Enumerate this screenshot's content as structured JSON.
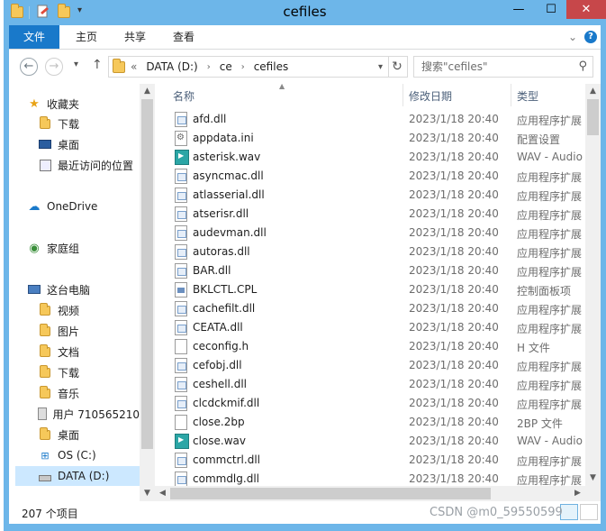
{
  "window": {
    "title": "cefiles",
    "minimize": "—",
    "maximize": "☐",
    "close": "✕"
  },
  "ribbon": {
    "tabs": [
      "文件",
      "主页",
      "共享",
      "查看"
    ],
    "expand_icon": "chevron-down-icon",
    "help": "?"
  },
  "navigation": {
    "back": "←",
    "forward": "→",
    "recent": "▾",
    "up": "↑",
    "path_prefix": "«",
    "breadcrumbs": [
      "DATA (D:)",
      "ce",
      "cefiles"
    ],
    "refresh": "↻",
    "search_placeholder": "搜索\"cefiles\""
  },
  "sidebar": {
    "items": [
      {
        "label": "收藏夹",
        "icon": "star-icon"
      },
      {
        "label": "下载",
        "icon": "download-folder-icon"
      },
      {
        "label": "桌面",
        "icon": "desktop-icon"
      },
      {
        "label": "最近访问的位置",
        "icon": "recent-places-icon"
      },
      {
        "label": "OneDrive",
        "icon": "cloud-icon"
      },
      {
        "label": "家庭组",
        "icon": "homegroup-icon"
      },
      {
        "label": "这台电脑",
        "icon": "computer-icon"
      },
      {
        "label": "视频",
        "icon": "videos-folder-icon"
      },
      {
        "label": "图片",
        "icon": "pictures-folder-icon"
      },
      {
        "label": "文档",
        "icon": "documents-folder-icon"
      },
      {
        "label": "下载",
        "icon": "download-folder-icon"
      },
      {
        "label": "音乐",
        "icon": "music-folder-icon"
      },
      {
        "label": "用户 710565210",
        "icon": "user-folder-icon"
      },
      {
        "label": "桌面",
        "icon": "desktop-folder-icon"
      },
      {
        "label": "OS (C:)",
        "icon": "windows-drive-icon"
      },
      {
        "label": "DATA (D:)",
        "icon": "drive-icon",
        "selected": true
      }
    ]
  },
  "columns": {
    "name": "名称",
    "date": "修改日期",
    "type": "类型"
  },
  "files": [
    {
      "name": "afd.dll",
      "date": "2023/1/18 20:40",
      "type": "应用程序扩展",
      "kind": "dll"
    },
    {
      "name": "appdata.ini",
      "date": "2023/1/18 20:40",
      "type": "配置设置",
      "kind": "ini"
    },
    {
      "name": "asterisk.wav",
      "date": "2023/1/18 20:40",
      "type": "WAV - Audio Fi",
      "kind": "wav"
    },
    {
      "name": "asyncmac.dll",
      "date": "2023/1/18 20:40",
      "type": "应用程序扩展",
      "kind": "dll"
    },
    {
      "name": "atlasserial.dll",
      "date": "2023/1/18 20:40",
      "type": "应用程序扩展",
      "kind": "dll"
    },
    {
      "name": "atserisr.dll",
      "date": "2023/1/18 20:40",
      "type": "应用程序扩展",
      "kind": "dll"
    },
    {
      "name": "audevman.dll",
      "date": "2023/1/18 20:40",
      "type": "应用程序扩展",
      "kind": "dll"
    },
    {
      "name": "autoras.dll",
      "date": "2023/1/18 20:40",
      "type": "应用程序扩展",
      "kind": "dll"
    },
    {
      "name": "BAR.dll",
      "date": "2023/1/18 20:40",
      "type": "应用程序扩展",
      "kind": "dll"
    },
    {
      "name": "BKLCTL.CPL",
      "date": "2023/1/18 20:40",
      "type": "控制面板项",
      "kind": "cpl"
    },
    {
      "name": "cachefilt.dll",
      "date": "2023/1/18 20:40",
      "type": "应用程序扩展",
      "kind": "dll"
    },
    {
      "name": "CEATA.dll",
      "date": "2023/1/18 20:40",
      "type": "应用程序扩展",
      "kind": "dll"
    },
    {
      "name": "ceconfig.h",
      "date": "2023/1/18 20:40",
      "type": "H 文件",
      "kind": "h"
    },
    {
      "name": "cefobj.dll",
      "date": "2023/1/18 20:40",
      "type": "应用程序扩展",
      "kind": "dll"
    },
    {
      "name": "ceshell.dll",
      "date": "2023/1/18 20:40",
      "type": "应用程序扩展",
      "kind": "dll"
    },
    {
      "name": "clcdckmif.dll",
      "date": "2023/1/18 20:40",
      "type": "应用程序扩展",
      "kind": "dll"
    },
    {
      "name": "close.2bp",
      "date": "2023/1/18 20:40",
      "type": "2BP 文件",
      "kind": "2bp"
    },
    {
      "name": "close.wav",
      "date": "2023/1/18 20:40",
      "type": "WAV - Audio Fi",
      "kind": "wav"
    },
    {
      "name": "commctrl.dll",
      "date": "2023/1/18 20:40",
      "type": "应用程序扩展",
      "kind": "dll"
    },
    {
      "name": "commdlg.dll",
      "date": "2023/1/18 20:40",
      "type": "应用程序扩展",
      "kind": "dll"
    }
  ],
  "status": {
    "item_count": "207 个项目"
  },
  "watermark": "CSDN @m0_59550599"
}
